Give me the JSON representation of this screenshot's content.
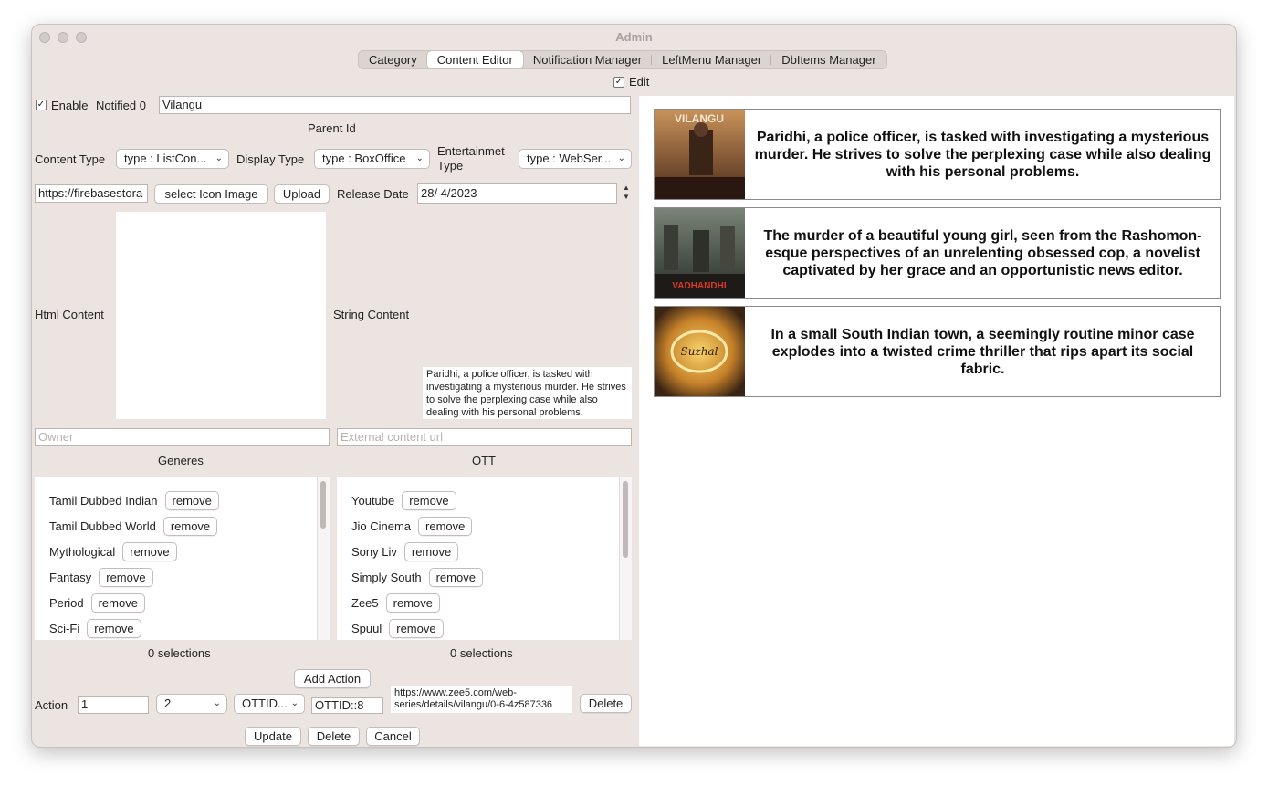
{
  "window": {
    "title": "Admin"
  },
  "tabs": [
    "Category",
    "Content Editor",
    "Notification Manager",
    "LeftMenu Manager",
    "DbItems Manager"
  ],
  "edit_toggle": {
    "label": "Edit",
    "checked": true
  },
  "form": {
    "enable_label": "Enable",
    "notified_label": "Notified 0",
    "name_value": "Vilangu",
    "parent_id_label": "Parent Id",
    "content_type_label": "Content Type",
    "content_type_value": "type : ListCon...",
    "display_type_label": "Display Type",
    "display_type_value": "type : BoxOffice",
    "entertainment_type_label": "Entertainmet Type",
    "entertainment_type_value": "type : WebSer...",
    "icon_url_value": "https://firebasestora",
    "select_icon_label": "select Icon Image",
    "upload_label": "Upload",
    "release_date_label": "Release Date",
    "release_date_value": "28/ 4/2023",
    "html_content_label": "Html Content",
    "string_content_label": "String Content",
    "string_content_value": "Paridhi, a police officer, is tasked with investigating a mysterious murder. He strives to solve the perplexing case while also dealing with his personal problems.",
    "owner_placeholder": "Owner",
    "external_url_placeholder": "External content url",
    "genres_label": "Generes",
    "ott_label": "OTT",
    "remove_label": "remove",
    "genres": [
      "Tamil Dubbed Indian",
      "Tamil Dubbed World",
      "Mythological",
      "Fantasy",
      "Period",
      "Sci-Fi"
    ],
    "ott": [
      "Youtube",
      "Jio Cinema",
      "Sony Liv",
      "Simply South",
      "Zee5",
      "Spuul"
    ],
    "genres_selections": "0 selections",
    "ott_selections": "0 selections",
    "add_action_label": "Add Action",
    "action_label": "Action",
    "action_value": "1",
    "action_select_value": "2",
    "action_type_value": "OTTID...",
    "action_id_value": "OTTID::8",
    "action_url_value": "https://www.zee5.com/web-series/details/vilangu/0-6-4z587336",
    "action_delete_label": "Delete",
    "update_label": "Update",
    "delete_label": "Delete",
    "cancel_label": "Cancel"
  },
  "preview": [
    {
      "text": "Paridhi, a police officer, is tasked with investigating a mysterious murder. He strives to solve the perplexing case while also dealing with his personal problems.",
      "poster_label": "VILANGU"
    },
    {
      "text": "The murder of a beautiful young girl, seen from the Rashomon-esque perspectives of an unrelenting obsessed cop, a novelist captivated by her grace and an opportunistic news editor.",
      "poster_label": "VADHANDHI"
    },
    {
      "text": "In a small South Indian town, a seemingly routine minor case explodes into a twisted crime thriller that rips apart its social fabric.",
      "poster_label": "Suzhal"
    }
  ]
}
